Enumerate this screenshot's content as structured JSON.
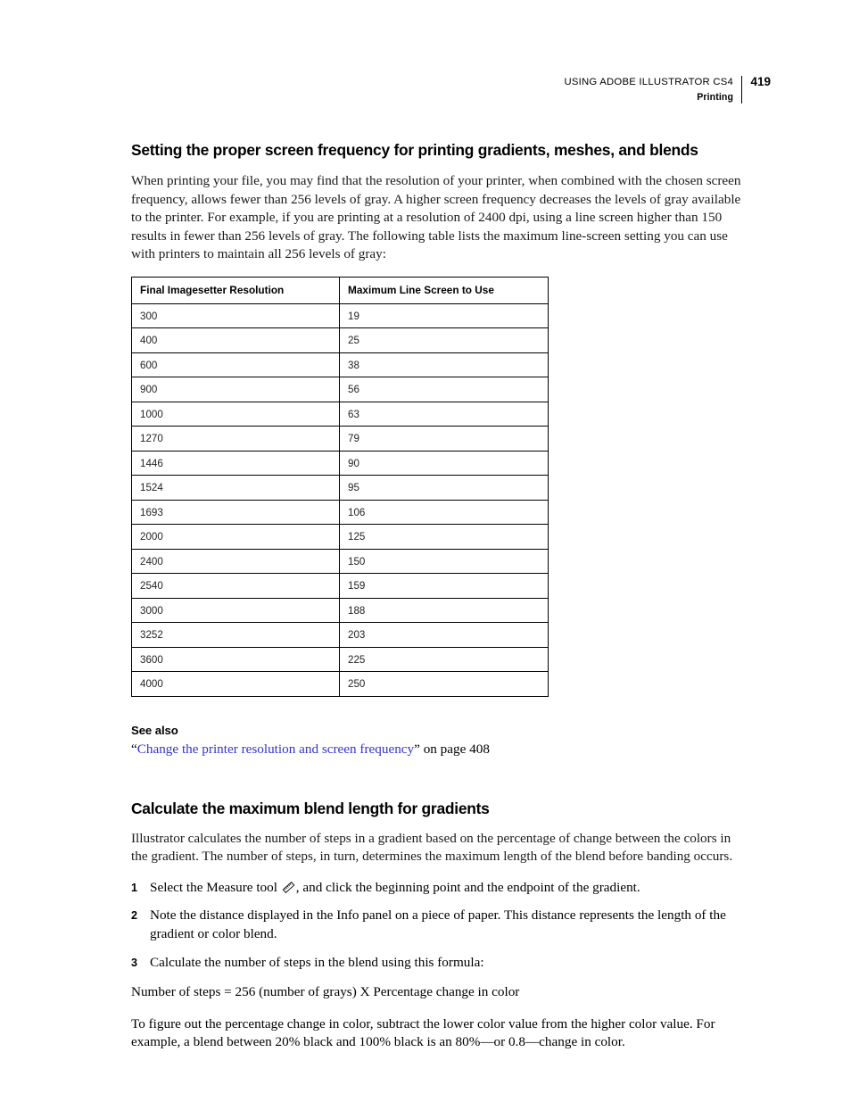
{
  "header": {
    "book_title": "USING ADOBE ILLUSTRATOR CS4",
    "section": "Printing",
    "page_number": "419"
  },
  "section1": {
    "title": "Setting the proper screen frequency for printing gradients, meshes, and blends",
    "intro": "When printing your file, you may find that the resolution of your printer, when combined with the chosen screen frequency, allows fewer than 256 levels of gray. A higher screen frequency decreases the levels of gray available to the printer. For example, if you are printing at a resolution of 2400 dpi, using a line screen higher than 150 results in fewer than 256 levels of gray. The following table lists the maximum line-screen setting you can use with printers to maintain all 256 levels of gray:",
    "table": {
      "columns": [
        "Final Imagesetter Resolution",
        "Maximum Line Screen to Use"
      ],
      "rows": [
        [
          "300",
          "19"
        ],
        [
          "400",
          "25"
        ],
        [
          "600",
          "38"
        ],
        [
          "900",
          "56"
        ],
        [
          "1000",
          "63"
        ],
        [
          "1270",
          "79"
        ],
        [
          "1446",
          "90"
        ],
        [
          "1524",
          "95"
        ],
        [
          "1693",
          "106"
        ],
        [
          "2000",
          "125"
        ],
        [
          "2400",
          "150"
        ],
        [
          "2540",
          "159"
        ],
        [
          "3000",
          "188"
        ],
        [
          "3252",
          "203"
        ],
        [
          "3600",
          "225"
        ],
        [
          "4000",
          "250"
        ]
      ]
    },
    "see_also_heading": "See also",
    "see_also_open_quote": "“",
    "see_also_link": "Change the printer resolution and screen frequency",
    "see_also_close_quote": "”",
    "see_also_suffix": " on page 408"
  },
  "section2": {
    "title": "Calculate the maximum blend length for gradients",
    "intro": "Illustrator calculates the number of steps in a gradient based on the percentage of change between the colors in the gradient. The number of steps, in turn, determines the maximum length of the blend before banding occurs.",
    "steps": [
      {
        "number": "1",
        "text_before_icon": "Select the Measure tool ",
        "icon": "measure-tool-icon",
        "text_after_icon": ", and click the beginning point and the endpoint of the gradient."
      },
      {
        "number": "2",
        "text": "Note the distance displayed in the Info panel on a piece of paper. This distance represents the length of the gradient or color blend."
      },
      {
        "number": "3",
        "text": "Calculate the number of steps in the blend using this formula:"
      }
    ],
    "formula": "Number of steps = 256 (number of grays) X Percentage change in color",
    "closing": "To figure out the percentage change in color, subtract the lower color value from the higher color value. For example, a blend between 20% black and 100% black is an 80%—or 0.8—change in color."
  },
  "colors": {
    "link": "#3333CC",
    "text": "#000000",
    "table_border": "#000000"
  }
}
